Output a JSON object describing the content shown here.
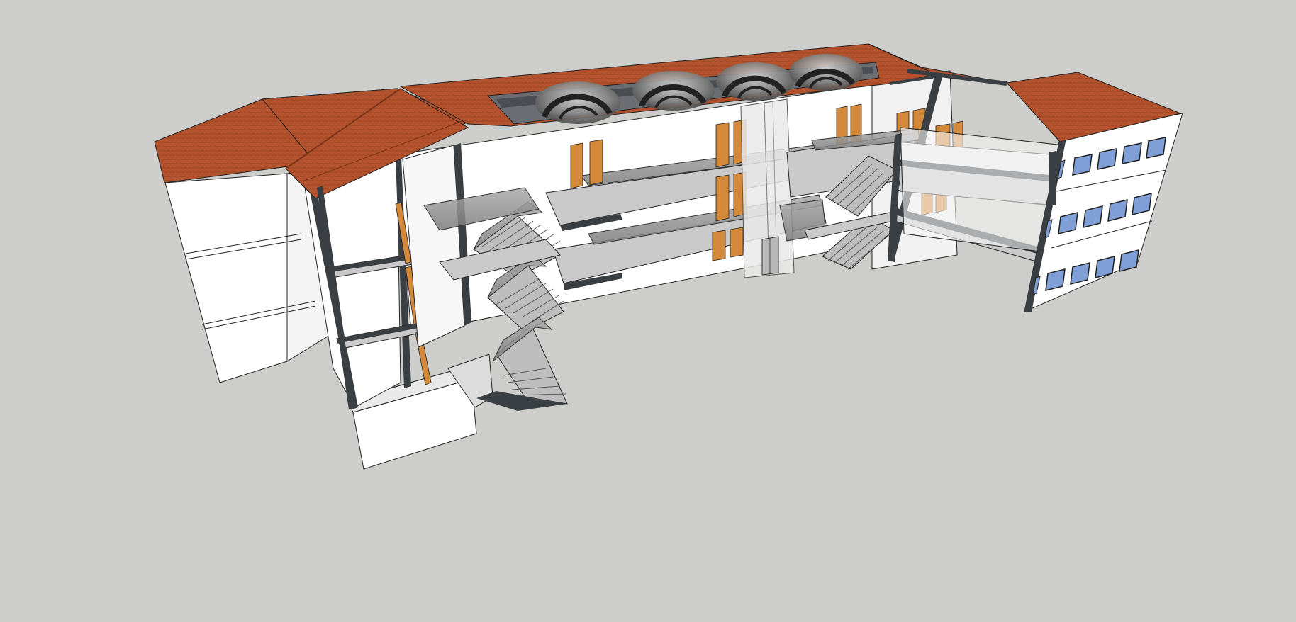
{
  "app": {
    "viewport_background": "#cdcecb",
    "tool": "3d-model-viewport"
  },
  "model": {
    "description_name": "building-section-model",
    "colors": {
      "roof": "#b5542e",
      "roof_dark": "#8f3f22",
      "wall": "#ffffff",
      "wall_shade": "#efefef",
      "floor_slab": "#c9c9c9",
      "cut_edge": "#3a3f44",
      "door": "#d4893a",
      "window_glass": "#7f9fd6",
      "glass_railing": "#9a9a9a",
      "skylight": "#8a8a8a"
    }
  }
}
